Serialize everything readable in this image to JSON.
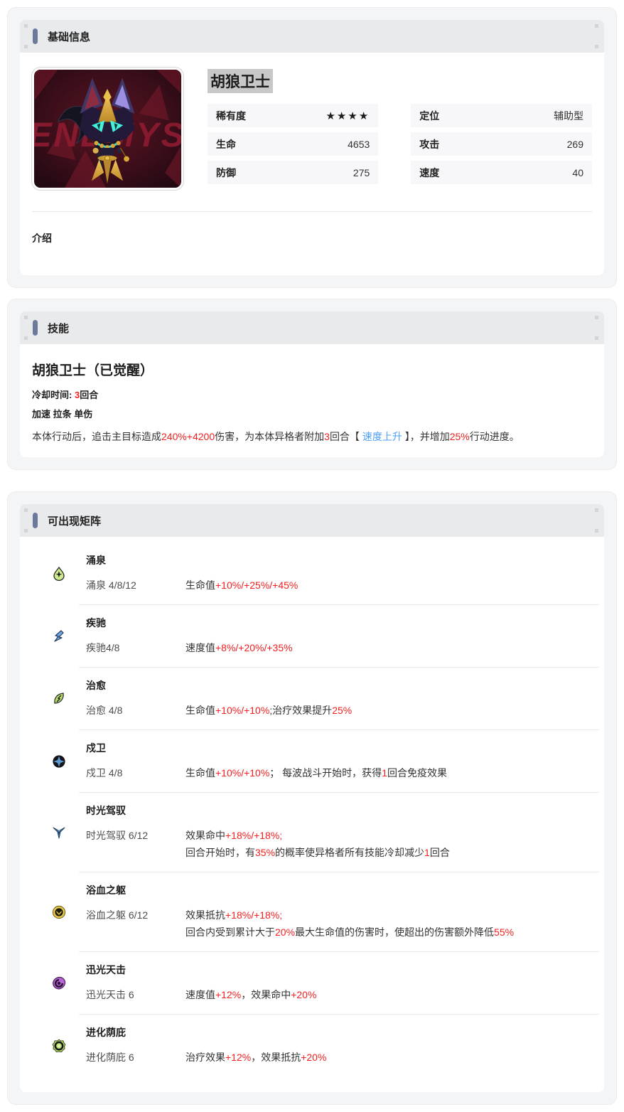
{
  "sections": {
    "basic": {
      "title": "基础信息"
    },
    "skill": {
      "title": "技能"
    },
    "matrix": {
      "title": "可出现矩阵"
    }
  },
  "basic": {
    "name": "胡狼卫士",
    "image_text": "ENEMYS",
    "stats": [
      {
        "label": "稀有度",
        "value": "★★★★"
      },
      {
        "label": "定位",
        "value": "辅助型"
      },
      {
        "label": "生命",
        "value": "4653"
      },
      {
        "label": "攻击",
        "value": "269"
      },
      {
        "label": "防御",
        "value": "275"
      },
      {
        "label": "速度",
        "value": "40"
      }
    ],
    "intro_label": "介绍"
  },
  "skill": {
    "name": "胡狼卫士（已觉醒）",
    "cooldown": [
      {
        "t": "冷却时间: ",
        "c": "d"
      },
      {
        "t": "3",
        "c": "r"
      },
      {
        "t": "回合",
        "c": "d"
      }
    ],
    "tags": "加速 拉条 单伤",
    "desc": [
      {
        "t": "本体行动后，追击主目标造成",
        "c": "d"
      },
      {
        "t": "240%+4200",
        "c": "r"
      },
      {
        "t": "伤害，为本体异格者附加",
        "c": "d"
      },
      {
        "t": "3",
        "c": "r"
      },
      {
        "t": "回合【 ",
        "c": "d"
      },
      {
        "t": "速度上升",
        "c": "b"
      },
      {
        "t": " 】，并增加",
        "c": "d"
      },
      {
        "t": "25%",
        "c": "r"
      },
      {
        "t": "行动进度。",
        "c": "d"
      }
    ]
  },
  "matrix": {
    "items": [
      {
        "name": "涌泉",
        "icon": "spring-droplet-icon",
        "level": "涌泉 4/8/12",
        "lines": [
          [
            {
              "t": "生命值",
              "c": "d"
            },
            {
              "t": "+10%/+25%/+45%",
              "c": "r"
            }
          ]
        ]
      },
      {
        "name": "疾驰",
        "icon": "gallop-icon",
        "level": "疾驰4/8",
        "lines": [
          [
            {
              "t": "速度值",
              "c": "d"
            },
            {
              "t": "+8%/+20%/+35%",
              "c": "r"
            }
          ]
        ]
      },
      {
        "name": "治愈",
        "icon": "heal-leaf-icon",
        "level": "治愈 4/8",
        "lines": [
          [
            {
              "t": "生命值",
              "c": "d"
            },
            {
              "t": "+10%/+10%",
              "c": "r"
            },
            {
              "t": ";治疗效果提升",
              "c": "d"
            },
            {
              "t": "25%",
              "c": "r"
            }
          ]
        ]
      },
      {
        "name": "戍卫",
        "icon": "guard-star-icon",
        "level": "戍卫 4/8",
        "lines": [
          [
            {
              "t": "生命值",
              "c": "d"
            },
            {
              "t": "+10%/+10%",
              "c": "r"
            },
            {
              "t": "； 每波战斗开始时，获得",
              "c": "d"
            },
            {
              "t": "1",
              "c": "r"
            },
            {
              "t": "回合免疫效果",
              "c": "d"
            }
          ]
        ]
      },
      {
        "name": "时光驾驭",
        "icon": "time-control-icon",
        "level": "时光驾驭 6/12",
        "lines": [
          [
            {
              "t": "效果命中",
              "c": "d"
            },
            {
              "t": "+18%/+18%;",
              "c": "r"
            }
          ],
          [
            {
              "t": "回合开始时，有",
              "c": "d"
            },
            {
              "t": "35%",
              "c": "r"
            },
            {
              "t": "的概率使异格者所有技能冷却减少",
              "c": "d"
            },
            {
              "t": "1",
              "c": "r"
            },
            {
              "t": "回合",
              "c": "d"
            }
          ]
        ]
      },
      {
        "name": "浴血之躯",
        "icon": "blood-body-icon",
        "level": "浴血之躯 6/12",
        "lines": [
          [
            {
              "t": "效果抵抗",
              "c": "d"
            },
            {
              "t": "+18%/+18%;",
              "c": "r"
            }
          ],
          [
            {
              "t": "回合内受到累计大于",
              "c": "d"
            },
            {
              "t": "20%",
              "c": "r"
            },
            {
              "t": "最大生命值的伤害时，使超出的伤害额外降低",
              "c": "d"
            },
            {
              "t": "55%",
              "c": "r"
            }
          ]
        ]
      },
      {
        "name": "迅光天击",
        "icon": "swift-strike-icon",
        "level": "迅光天击 6",
        "lines": [
          [
            {
              "t": "速度值",
              "c": "d"
            },
            {
              "t": "+12%",
              "c": "r"
            },
            {
              "t": "，效果命中",
              "c": "d"
            },
            {
              "t": "+20%",
              "c": "r"
            }
          ]
        ]
      },
      {
        "name": "进化荫庇",
        "icon": "evolve-shelter-icon",
        "level": "进化荫庇 6",
        "lines": [
          [
            {
              "t": "治疗效果",
              "c": "d"
            },
            {
              "t": "+12%",
              "c": "r"
            },
            {
              "t": "，效果抵抗",
              "c": "d"
            },
            {
              "t": "+20%",
              "c": "r"
            }
          ]
        ]
      }
    ]
  },
  "colors": {
    "red": "#ee2222",
    "link_blue": "#4d9ef7",
    "accent_bar": "#6b7a9b",
    "header_bg": "#e9eaec"
  }
}
